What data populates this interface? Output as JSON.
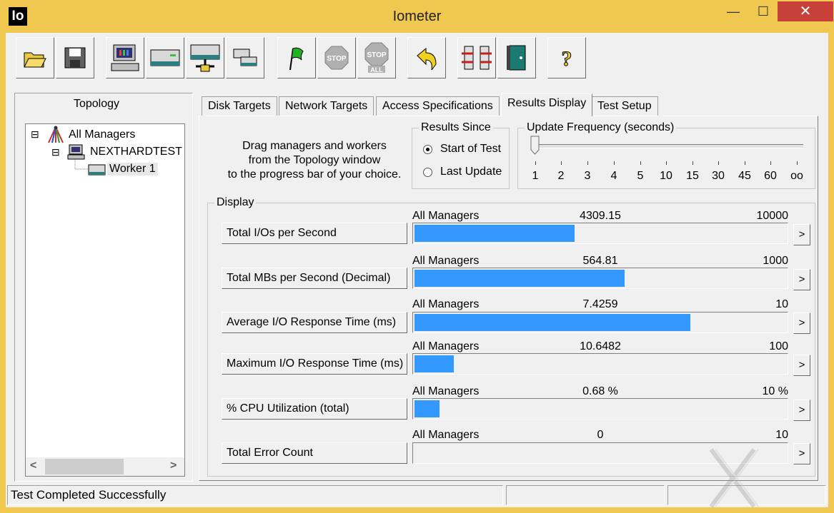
{
  "window": {
    "app_icon_text": "Io",
    "title": "Iometer",
    "minimize_glyph": "—",
    "maximize_glyph": "☐",
    "close_glyph": "✕"
  },
  "toolbar": {
    "buttons": [
      "open-config-icon",
      "save-config-icon",
      "new-manager-icon",
      "new-disk-worker-icon",
      "new-network-worker-icon",
      "duplicate-worker-icon",
      "start-test-icon",
      "stop-test-icon",
      "stop-all-icon",
      "reset-workers-icon",
      "disconnect-icon",
      "exit-icon",
      "about-icon"
    ]
  },
  "topology": {
    "label": "Topology",
    "tree": [
      {
        "label": "All Managers",
        "expander": "⊟"
      },
      {
        "label": "NEXTHARDTEST",
        "expander": "⊟"
      },
      {
        "label": "Worker 1"
      }
    ],
    "scroll_left": "<",
    "scroll_right": ">"
  },
  "tabs": [
    {
      "label": "Disk Targets",
      "active": false
    },
    {
      "label": "Network Targets",
      "active": false
    },
    {
      "label": "Access Specifications",
      "active": false
    },
    {
      "label": "Results Display",
      "active": true
    },
    {
      "label": "Test Setup",
      "active": false
    }
  ],
  "results_display": {
    "drag_hint": [
      "Drag managers and workers",
      "from the Topology window",
      "to the progress bar of your choice."
    ],
    "results_since": {
      "title": "Results Since",
      "options": [
        {
          "label": "Start of Test",
          "selected": true
        },
        {
          "label": "Last Update",
          "selected": false
        }
      ]
    },
    "update_frequency": {
      "title": "Update Frequency (seconds)",
      "ticks": [
        "1",
        "2",
        "3",
        "4",
        "5",
        "10",
        "15",
        "30",
        "45",
        "60",
        "oo"
      ],
      "selected": "1"
    },
    "display_title": "Display",
    "metrics": [
      {
        "button": "Total I/Os per Second",
        "manager": "All Managers",
        "value": "4309.15",
        "max": "10000",
        "fill_fraction": 0.4309
      },
      {
        "button": "Total MBs per Second (Decimal)",
        "manager": "All Managers",
        "value": "564.81",
        "max": "1000",
        "fill_fraction": 0.5648
      },
      {
        "button": "Average I/O Response Time (ms)",
        "manager": "All Managers",
        "value": "7.4259",
        "max": "10",
        "fill_fraction": 0.7426
      },
      {
        "button": "Maximum I/O Response Time (ms)",
        "manager": "All Managers",
        "value": "10.6482",
        "max": "100",
        "fill_fraction": 0.1065
      },
      {
        "button": "% CPU Utilization (total)",
        "manager": "All Managers",
        "value": "0.68 %",
        "max": "10 %",
        "fill_fraction": 0.068
      },
      {
        "button": "Total Error Count",
        "manager": "All Managers",
        "value": "0",
        "max": "10",
        "fill_fraction": 0
      }
    ],
    "arrow_glyph": ">"
  },
  "status_bar": {
    "message": "Test Completed Successfully"
  },
  "colors": {
    "title_bar": "#f0c850",
    "bar_fill": "#3399ff",
    "close_button": "#c7403a"
  }
}
